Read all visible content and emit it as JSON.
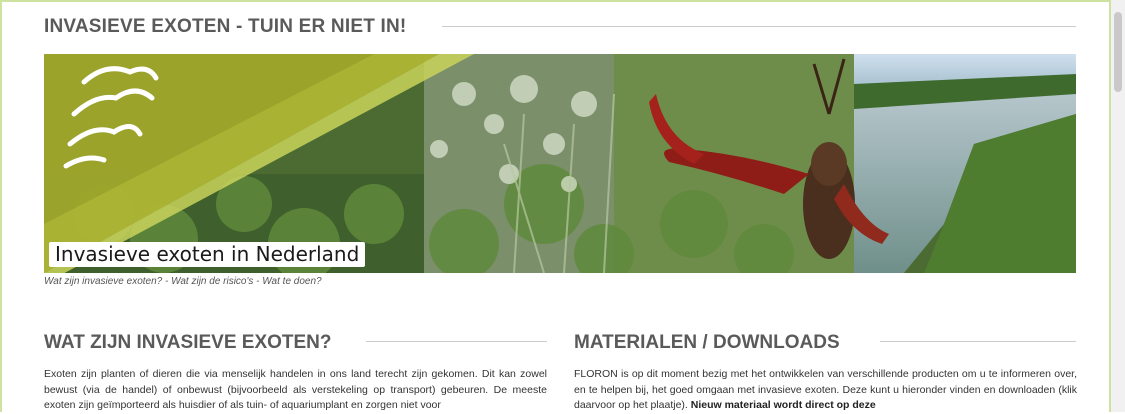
{
  "page": {
    "title": "INVASIEVE EXOTEN - TUIN ER NIET IN!"
  },
  "banner": {
    "caption": "Invasieve exoten in Nederland",
    "subcaption": "Wat zijn invasieve exoten? - Wat zijn de risico's - Wat te doen?",
    "colors": {
      "olive": "#9fa72b",
      "lime": "#c9d35a"
    }
  },
  "sections": {
    "what": {
      "heading": "WAT ZIJN INVASIEVE EXOTEN?",
      "body": "Exoten zijn planten of dieren die via menselijk handelen in ons land terecht zijn gekomen. Dit kan zowel bewust (via de handel) of onbewust (bijvoorbeeld als verstekeling op transport) gebeuren. De meeste exoten zijn geïmporteerd als huisdier of als tuin- of aquariumplant en zorgen niet voor"
    },
    "materials": {
      "heading": "MATERIALEN / DOWNLOADS",
      "body": "FLORON is op dit moment bezig met het ontwikkelen van verschillende producten om u te informeren over, en te helpen bij, het goed omgaan met invasieve exoten. Deze kunt u hieronder vinden en downloaden (klik daarvoor op het plaatje).",
      "body_bold": "Nieuw materiaal wordt direct op deze"
    }
  }
}
